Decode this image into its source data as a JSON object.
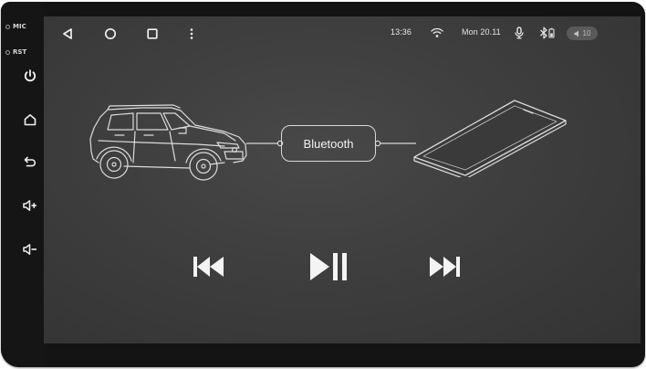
{
  "hardware": {
    "mic_label": "MIC",
    "rst_label": "RST",
    "buttons": [
      "power-icon",
      "home-icon",
      "back-icon",
      "volume-up-icon",
      "volume-down-icon"
    ]
  },
  "statusbar": {
    "nav": [
      "back-triangle-icon",
      "home-circle-icon",
      "recents-square-icon",
      "more-vert-icon"
    ],
    "time": "13:36",
    "date": "Mon 20.11",
    "volume_level": "10",
    "icons": [
      "wifi-icon",
      "microphone-icon",
      "bluetooth-icon",
      "volume-icon"
    ]
  },
  "main": {
    "connection_label": "Bluetooth",
    "controls": [
      "previous-track-icon",
      "play-pause-icon",
      "next-track-icon"
    ]
  },
  "colors": {
    "screen_bg": "#404040",
    "bezel": "#141414",
    "foreground": "#ececec"
  }
}
